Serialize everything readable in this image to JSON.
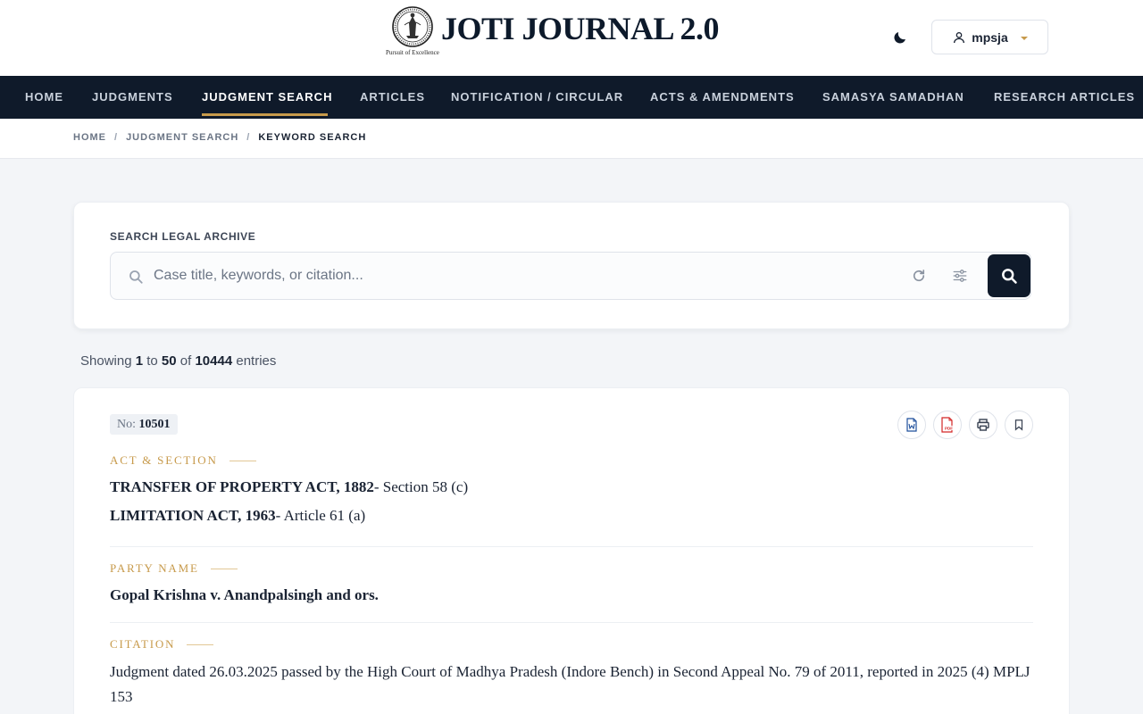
{
  "header": {
    "brand": "JOTI JOURNAL 2.0",
    "motto": "Pursuit of Excellence",
    "user": "mpsja"
  },
  "nav": {
    "items": [
      {
        "label": "HOME"
      },
      {
        "label": "JUDGMENTS"
      },
      {
        "label": "JUDGMENT SEARCH",
        "active": true
      },
      {
        "label": "ARTICLES"
      },
      {
        "label": "NOTIFICATION / CIRCULAR"
      },
      {
        "label": "ACTS & AMENDMENTS"
      },
      {
        "label": "SAMASYA SAMADHAN"
      },
      {
        "label": "RESEARCH ARTICLES"
      }
    ]
  },
  "breadcrumb": [
    "HOME",
    "JUDGMENT SEARCH",
    "KEYWORD SEARCH"
  ],
  "search": {
    "label": "SEARCH LEGAL ARCHIVE",
    "placeholder": "Case title, keywords, or citation...",
    "value": ""
  },
  "results": {
    "showing_word": "Showing",
    "from": "1",
    "to_word": "to",
    "to": "50",
    "of_word": "of",
    "total": "10444",
    "entries_word": "entries"
  },
  "record": {
    "no_label": "No:",
    "no_value": "10501",
    "act_heading": "ACT & SECTION",
    "acts": [
      {
        "act": "TRANSFER OF PROPERTY ACT, 1882",
        "section": "- Section 58 (c)"
      },
      {
        "act": "LIMITATION ACT, 1963",
        "section": "- Article 61 (a)"
      }
    ],
    "party_heading": "PARTY NAME",
    "party": "Gopal Krishna v. Anandpalsingh and ors.",
    "citation_heading": "CITATION",
    "citation": "Judgment dated 26.03.2025 passed by the High Court of Madhya Pradesh (Indore Bench) in Second Appeal No. 79 of 2011, reported in 2025 (4) MPLJ 153"
  },
  "colors": {
    "navy": "#0f1a2a",
    "gold": "#c79a4b",
    "word_blue": "#1e4f9c",
    "pdf_red": "#d32626"
  }
}
